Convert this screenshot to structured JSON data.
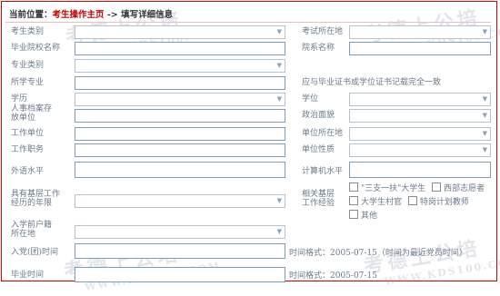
{
  "breadcrumb": {
    "prefix": "当前位置：",
    "link": "考生操作主页",
    "arrow": "->",
    "current": "填写详细信息"
  },
  "form": {
    "exam_type_label": "考生类别",
    "exam_location_label": "考试所在地",
    "graduate_school_label": "毕业院校名称",
    "department_label": "院系名称",
    "major_category_label": "专业类别",
    "major_label": "所学专业",
    "cert_note": "应与毕业证书或学位证书记载完全一致",
    "education_label": "学历",
    "degree_label": "学位",
    "archive_unit_label": "人事档案存放单位",
    "political_status_label": "政治面貌",
    "work_unit_label": "工作单位",
    "unit_location_label": "单位所在地",
    "job_title_label": "工作职务",
    "unit_nature_label": "单位性质",
    "foreign_language_label": "外语水平",
    "computer_level_label": "计算机水平",
    "grassroots_years_label": "具有基层工作经历的年限",
    "grassroots_exp_label": "相关基层工作经验",
    "exp_options": [
      "\"三支一扶\"大学生",
      "西部志愿者",
      "大学生村官",
      "特岗计划教师",
      "其他"
    ],
    "hukou_label": "入学前户籍所在地",
    "party_date_label": "入党(团)时间",
    "party_date_hint": "时间格式：2005-07-15（时间为最近党员时间）",
    "grad_date_label": "毕业时间",
    "grad_date_hint": "时间格式：2005-07-15"
  },
  "watermark": {
    "text": "考德上公培",
    "url": "WWW.KDS100.COM"
  }
}
